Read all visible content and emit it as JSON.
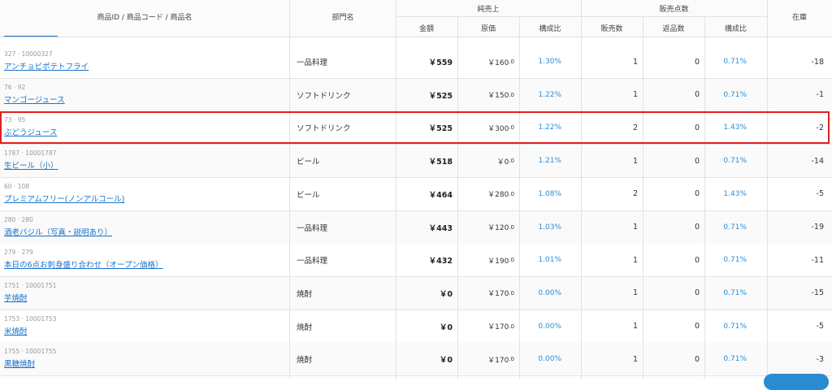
{
  "header": {
    "product_col": "商品ID / 商品コード / 商品名",
    "dept_col": "部門名",
    "net_sales_group": "純売上",
    "qty_group": "販売点数",
    "stock_col": "在庫",
    "amount_col": "金額",
    "cost_col": "原価",
    "ratio_col": "構成比",
    "sold_col": "販売数",
    "returned_col": "返品数",
    "qty_ratio_col": "構成比"
  },
  "rows": [
    {
      "pid": "327 · 10000327",
      "name": "アンチョビポテトフライ",
      "dept": "一品料理",
      "amount": "￥559",
      "cost": "￥160",
      "cost_dec": ".0",
      "ratio": "1.30%",
      "sold": "1",
      "returned": "0",
      "qty_ratio": "0.71%",
      "stock": "-18"
    },
    {
      "pid": "76 · 92",
      "name": "マンゴージュース",
      "dept": "ソフトドリンク",
      "amount": "￥525",
      "cost": "￥150",
      "cost_dec": ".0",
      "ratio": "1.22%",
      "sold": "1",
      "returned": "0",
      "qty_ratio": "0.71%",
      "stock": "-1"
    },
    {
      "pid": "73 · 95",
      "name": "ぶどうジュース",
      "dept": "ソフトドリンク",
      "amount": "￥525",
      "cost": "￥300",
      "cost_dec": ".0",
      "ratio": "1.22%",
      "sold": "2",
      "returned": "0",
      "qty_ratio": "1.43%",
      "stock": "-2"
    },
    {
      "pid": "1787 · 10001787",
      "name": "生ビール（小）",
      "dept": "ビール",
      "amount": "￥518",
      "cost": "￥0",
      "cost_dec": ".0",
      "ratio": "1.21%",
      "sold": "1",
      "returned": "0",
      "qty_ratio": "0.71%",
      "stock": "-14"
    },
    {
      "pid": "60 · 108",
      "name": "プレミアムフリー(ノンアルコール)",
      "dept": "ビール",
      "amount": "￥464",
      "cost": "￥280",
      "cost_dec": ".0",
      "ratio": "1.08%",
      "sold": "2",
      "returned": "0",
      "qty_ratio": "1.43%",
      "stock": "-5"
    },
    {
      "pid": "280 · 280",
      "name": "酒老バジル（写真・説明あり）",
      "dept": "一品料理",
      "amount": "￥443",
      "cost": "￥120",
      "cost_dec": ".0",
      "ratio": "1.03%",
      "sold": "1",
      "returned": "0",
      "qty_ratio": "0.71%",
      "stock": "-19"
    },
    {
      "pid": "279 · 279",
      "name": "本日の6点お刺身盛り合わせ（オープン価格）",
      "dept": "一品料理",
      "amount": "￥432",
      "cost": "￥190",
      "cost_dec": ".0",
      "ratio": "1.01%",
      "sold": "1",
      "returned": "0",
      "qty_ratio": "0.71%",
      "stock": "-11"
    },
    {
      "pid": "1751 · 10001751",
      "name": "芋焼酎",
      "dept": "焼酎",
      "amount": "￥0",
      "cost": "￥170",
      "cost_dec": ".0",
      "ratio": "0.00%",
      "sold": "1",
      "returned": "0",
      "qty_ratio": "0.71%",
      "stock": "-15"
    },
    {
      "pid": "1753 · 10001753",
      "name": "米焼酎",
      "dept": "焼酎",
      "amount": "￥0",
      "cost": "￥170",
      "cost_dec": ".0",
      "ratio": "0.00%",
      "sold": "1",
      "returned": "0",
      "qty_ratio": "0.71%",
      "stock": "-5"
    },
    {
      "pid": "1755 · 10001755",
      "name": "黒糖焼酎",
      "dept": "焼酎",
      "amount": "￥0",
      "cost": "￥170",
      "cost_dec": ".0",
      "ratio": "0.00%",
      "sold": "1",
      "returned": "0",
      "qty_ratio": "0.71%",
      "stock": "-3"
    }
  ]
}
